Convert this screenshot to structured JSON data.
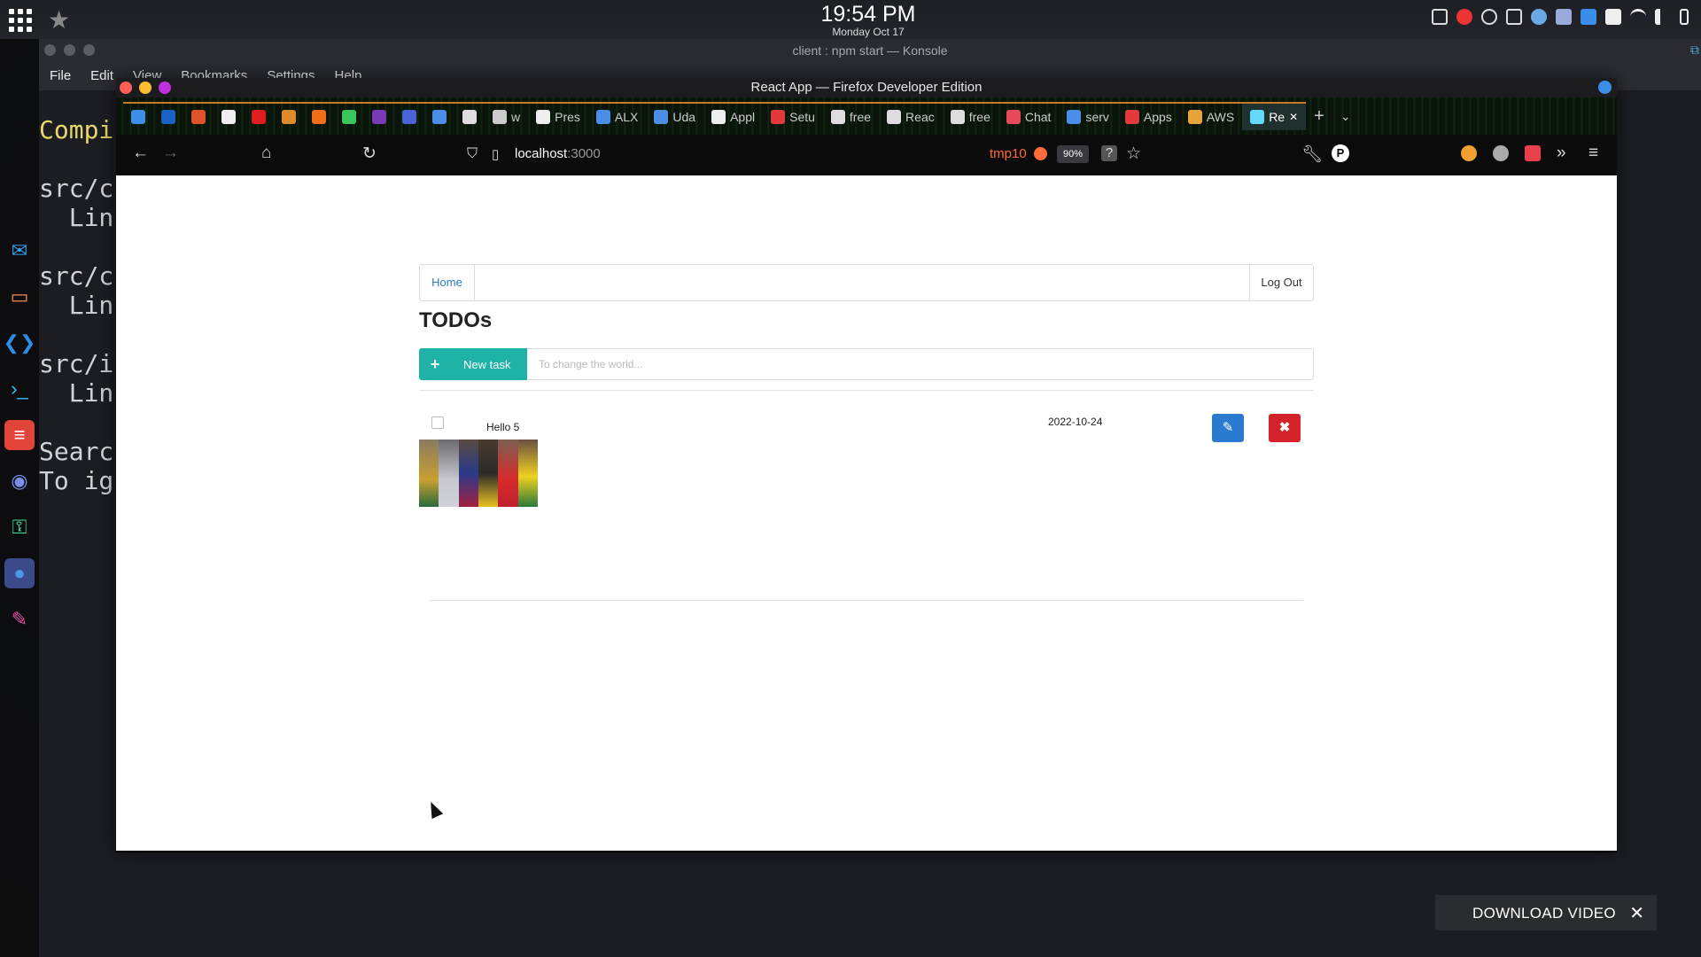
{
  "top_panel": {
    "time": "19:54 PM",
    "date": "Monday Oct 17"
  },
  "konsole": {
    "title": "client : npm start — Konsole",
    "menu": [
      "File",
      "Edit",
      "View",
      "Bookmarks",
      "Settings",
      "Help"
    ],
    "terminal_lines": [
      "Compi",
      "",
      "src/c",
      "  Lin",
      "",
      "src/c",
      "  Lin",
      "",
      "src/i",
      "  Lin",
      "",
      "Searc",
      "To ig"
    ]
  },
  "firefox": {
    "title": "React App — Firefox Developer Edition",
    "tabs": [
      {
        "label": "",
        "color": "#3c8ee8"
      },
      {
        "label": "",
        "color": "#1a63c4"
      },
      {
        "label": "",
        "color": "#e2522a"
      },
      {
        "label": "",
        "color": "#eeeeee"
      },
      {
        "label": "",
        "color": "#e21d1d"
      },
      {
        "label": "",
        "color": "#e08a2a"
      },
      {
        "label": "",
        "color": "#f06f1b"
      },
      {
        "label": "",
        "color": "#37c75a"
      },
      {
        "label": "",
        "color": "#7a3ab5"
      },
      {
        "label": "",
        "color": "#4a63d8"
      },
      {
        "label": "",
        "color": "#4a8ee8"
      },
      {
        "label": "",
        "color": "#dddddd"
      },
      {
        "label": "w",
        "color": "#cccccc"
      },
      {
        "label": "Pres",
        "color": "#eeeeee"
      },
      {
        "label": "ALX",
        "color": "#4a8ee8"
      },
      {
        "label": "Uda",
        "color": "#4a8ee8"
      },
      {
        "label": "Appl",
        "color": "#eeeeee"
      },
      {
        "label": "Setu",
        "color": "#e23a3a"
      },
      {
        "label": "free",
        "color": "#dddddd"
      },
      {
        "label": "Reac",
        "color": "#dddddd"
      },
      {
        "label": "free",
        "color": "#dddddd"
      },
      {
        "label": "Chat",
        "color": "#e84a5a"
      },
      {
        "label": "serv",
        "color": "#4a8ee8"
      },
      {
        "label": "Apps",
        "color": "#e23a3a"
      },
      {
        "label": "AWS",
        "color": "#e8a33a"
      },
      {
        "label": "Re",
        "color": "#61dafb",
        "active": true
      }
    ],
    "url": "localhost",
    "url_port": ":3000",
    "profile": "tmp10",
    "zoom": "90%"
  },
  "page": {
    "nav": {
      "home": "Home",
      "logout": "Log Out"
    },
    "title": "TODOs",
    "new_task": {
      "label": "New task",
      "placeholder": "To change the world..."
    },
    "todos": [
      {
        "title": "Hello 5",
        "date": "2022-10-24",
        "checked": false
      }
    ]
  },
  "download_banner": {
    "label": "DOWNLOAD VIDEO"
  }
}
